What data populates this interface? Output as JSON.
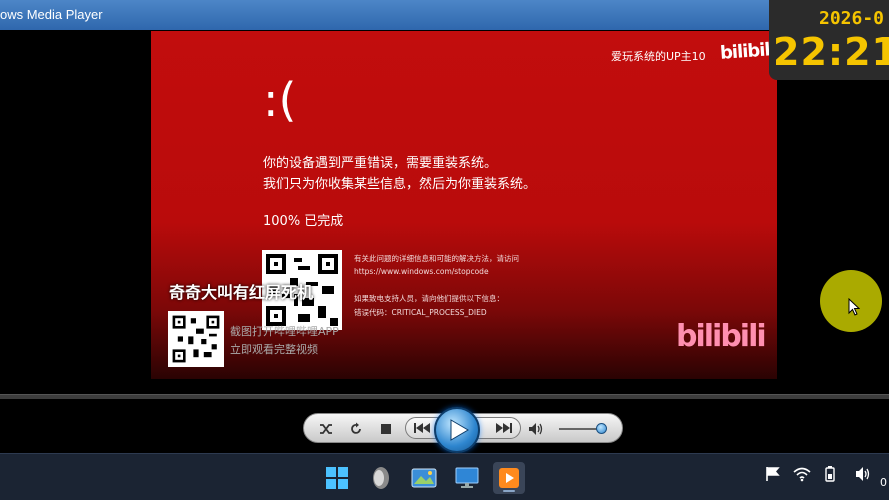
{
  "window": {
    "title": "ows Media Player"
  },
  "video": {
    "uploader": "爱玩系统的UP主10",
    "logo_top": "bilibili",
    "sad_face": ":(",
    "message_line1": "你的设备遇到严重错误，需要重装系统。",
    "message_line2": "我们只为你收集某些信息，然后为你重装系统。",
    "progress": "100% 已完成",
    "info_line1": "有关此问题的详细信息和可能的解决方法，请访问",
    "info_line2": "https://www.windows.com/stopcode",
    "info_line3": "如果致电支持人员，请向他们提供以下信息：",
    "info_line4": "错误代码：CRITICAL_PROCESS_DIED",
    "promo_title": "奇奇大叫有红屏死机",
    "promo_line1": "截图打开哔哩哔哩APP",
    "promo_line2": "立即观看完整视频",
    "logo_bottom": "bilibili"
  },
  "clock_overlay": {
    "date": "2026-0",
    "hour": "22",
    "sep": ":",
    "minute": "21"
  },
  "player_controls": {
    "volume_level": 0.85,
    "icons": [
      "shuffle-icon",
      "repeat-icon",
      "stop-icon",
      "previous-icon",
      "play-icon",
      "next-icon",
      "volume-icon"
    ]
  },
  "tray": {
    "partial_text": "0"
  },
  "colors": {
    "bsod_red": "#c20d0d",
    "clock_yellow": "#f5c400",
    "taskbar": "#1b2433",
    "cursor_highlight": "#c8c800"
  }
}
